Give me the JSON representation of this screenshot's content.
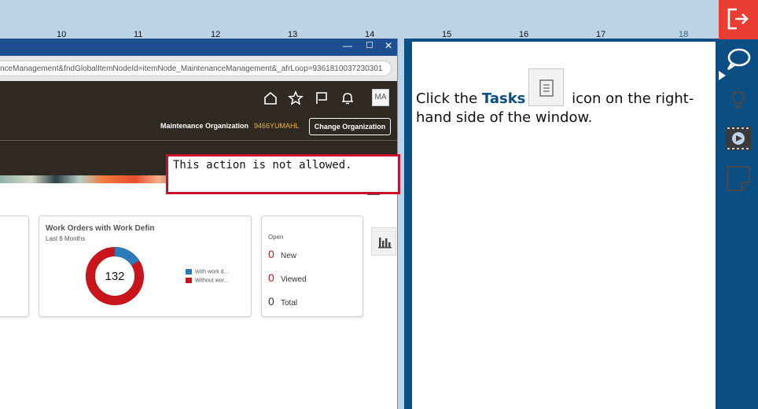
{
  "ruler": {
    "ticks": [
      "10",
      "11",
      "12",
      "13",
      "14",
      "15",
      "16",
      "17",
      "18"
    ]
  },
  "browser": {
    "window_controls": {
      "minimize": "—",
      "maximize": "☐",
      "close": "✕"
    },
    "url": "nceManagement&fndGlobalItemNodeId=itemNode_MaintenanceManagement&_afrLoop=9361810037230301",
    "app_icons": [
      "home-icon",
      "favorites-star-icon",
      "flag-icon",
      "notifications-bell-icon"
    ],
    "avatar": "MA",
    "org_label": "Maintenance Organization",
    "org_value": "9466YUMAHL",
    "change_org_button": "Change Organization"
  },
  "work_orders_card": {
    "title": "Work Orders with Work Defin",
    "subtitle": "Last 6 Months",
    "center_value": "132",
    "legend": [
      {
        "label": "With work d...",
        "color": "#2b7bb9"
      },
      {
        "label": "Without wor...",
        "color": "#c8151b"
      }
    ]
  },
  "counts_card": {
    "header": "Open",
    "rows": [
      {
        "value": "0",
        "label": "New",
        "color": "#c8151b"
      },
      {
        "value": "0",
        "label": "Viewed",
        "color": "#c8151b"
      },
      {
        "value": "0",
        "label": "Total",
        "color": "#333333"
      }
    ]
  },
  "error": {
    "message": "This action is not allowed."
  },
  "instruction": {
    "prefix": "Click the ",
    "highlight": "Tasks",
    "suffix": " icon on the right-hand side of the window."
  },
  "side_toolbar": {
    "items": [
      "exit-icon",
      "speech-bubble-icon",
      "lightbulb-icon",
      "video-icon",
      "note-icon"
    ]
  },
  "colors": {
    "accent_blue": "#0b4e83",
    "exit_red": "#ea3e34",
    "error_red": "#c8102e"
  }
}
